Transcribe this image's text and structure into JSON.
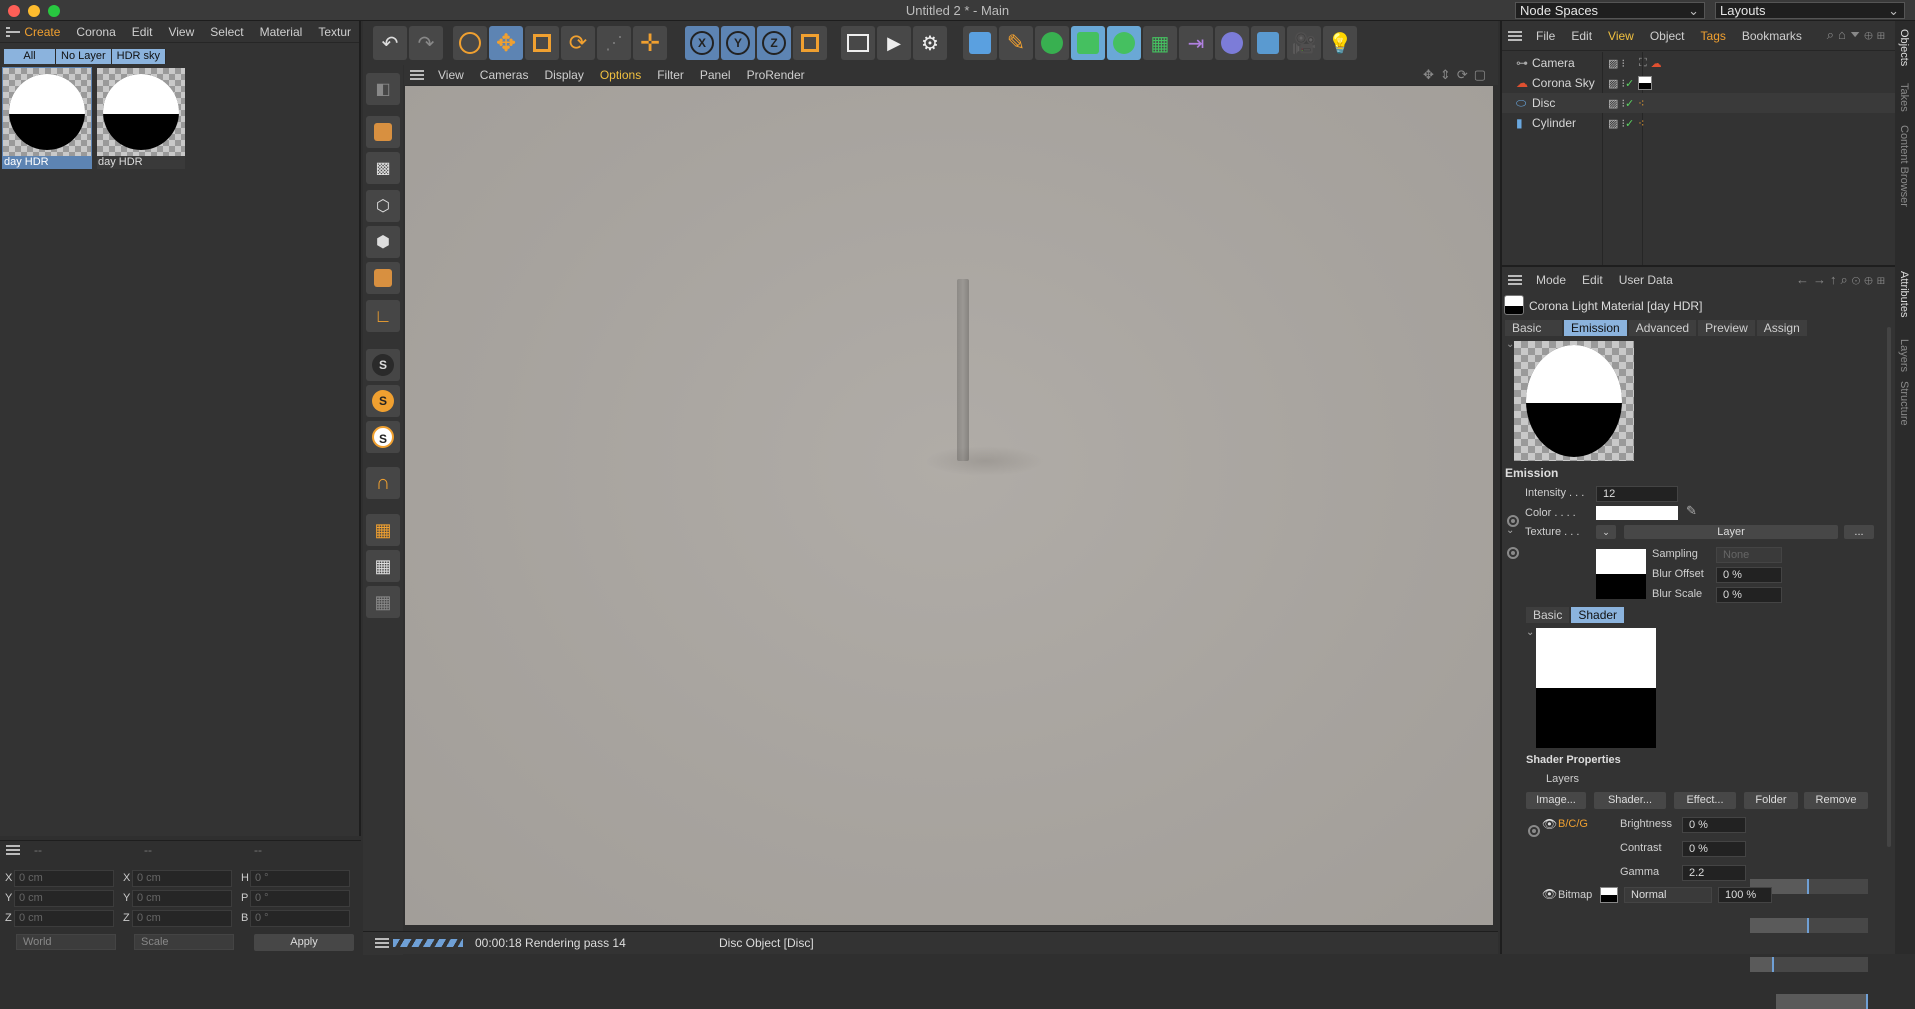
{
  "window": {
    "title": "Untitled 2 * - Main"
  },
  "top_right": {
    "node_spaces": "Node Spaces",
    "layouts": "Layouts"
  },
  "left_menu": [
    "Create",
    "Corona",
    "Edit",
    "View",
    "Select",
    "Material",
    "Textur"
  ],
  "layer_filters": [
    "All",
    "No Layer",
    "HDR sky"
  ],
  "materials": [
    {
      "label": "day HDR"
    },
    {
      "label": "day HDR"
    }
  ],
  "coords": {
    "headers": [
      "--",
      "--",
      "--"
    ],
    "rows": [
      {
        "a": "X",
        "av": "0 cm",
        "b": "X",
        "bv": "0 cm",
        "c": "H",
        "cv": "0 °"
      },
      {
        "a": "Y",
        "av": "0 cm",
        "b": "Y",
        "bv": "0 cm",
        "c": "P",
        "cv": "0 °"
      },
      {
        "a": "Z",
        "av": "0 cm",
        "b": "Z",
        "bv": "0 cm",
        "c": "B",
        "cv": "0 °"
      }
    ],
    "world": "World",
    "scale": "Scale",
    "apply": "Apply"
  },
  "viewport_menu": [
    "View",
    "Cameras",
    "Display",
    "Options",
    "Filter",
    "Panel",
    "ProRender"
  ],
  "status": {
    "time": "00:00:18 Rendering pass 14",
    "object": "Disc Object [Disc]"
  },
  "objects_menu": [
    "File",
    "Edit",
    "View",
    "Object",
    "Tags",
    "Bookmarks"
  ],
  "objects": [
    {
      "name": "Camera"
    },
    {
      "name": "Corona Sky"
    },
    {
      "name": "Disc"
    },
    {
      "name": "Cylinder"
    }
  ],
  "attr_menu": [
    "Mode",
    "Edit",
    "User Data"
  ],
  "attr": {
    "title": "Corona Light Material [day HDR]",
    "tabs": [
      "Basic",
      "Emission",
      "Advanced",
      "Preview",
      "Assign"
    ],
    "section": "Emission",
    "intensity_label": "Intensity . . .",
    "intensity": "12",
    "color_label": "Color . . . .",
    "texture_label": "Texture . . .",
    "layer_btn": "Layer",
    "more_btn": "...",
    "sampling_label": "Sampling",
    "sampling": "None",
    "blur_offset_label": "Blur Offset",
    "blur_offset": "0 %",
    "blur_scale_label": "Blur Scale",
    "blur_scale": "0 %",
    "sub_tabs": [
      "Basic",
      "Shader"
    ],
    "shader_props": "Shader Properties",
    "layers_label": "Layers",
    "layer_buttons": [
      "Image...",
      "Shader...",
      "Effect...",
      "Folder",
      "Remove"
    ],
    "bcg": "B/C/G",
    "brightness_label": "Brightness",
    "brightness": "0 %",
    "brightness_level": 0.5,
    "contrast_label": "Contrast",
    "contrast": "0 %",
    "contrast_level": 0.5,
    "gamma_label": "Gamma",
    "gamma": "2.2",
    "gamma_level": 0.2,
    "bitmap_label": "Bitmap",
    "blend": "Normal",
    "opacity": "100 %"
  },
  "side_tabs_top": [
    "Objects",
    "Takes",
    "Content Browser"
  ],
  "side_tabs_bottom": [
    "Attributes",
    "Layers",
    "Structure"
  ],
  "colors": {
    "accent": "#f0a030",
    "select": "#5d84b3"
  }
}
